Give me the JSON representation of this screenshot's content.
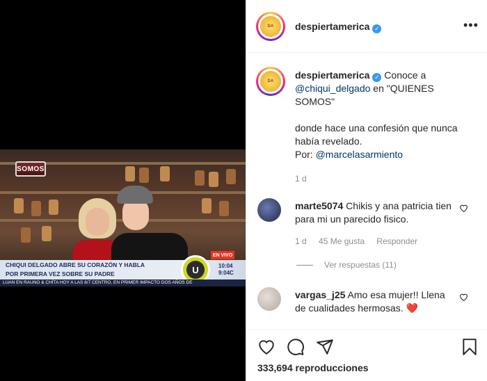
{
  "video": {
    "badge": "SOMOS",
    "live_badge": "EN VIVO",
    "headline_line1": "CHIQUI DELGADO ABRE SU CORAZÓN Y HABLA",
    "headline_line2": "POR PRIMERA VEZ SOBRE SU PADRE",
    "clock_line1": "10:04",
    "clock_line2": "9:04C",
    "ticker": "LUAN EN RAUNO & CHÍTA  HOY A LAS 8/7 CENTRO, EN PRIMER IMPACTO DOS AÑOS DE"
  },
  "post": {
    "username": "despiertamerica",
    "caption_intro": "Conoce a",
    "mention1": "@chiqui_delgado",
    "caption_mid": "en \"QUIENES SOMOS\"",
    "caption_body": "donde hace una confesión que nunca había revelado.",
    "caption_by": "Por:",
    "mention2": "@marcelasarmiento",
    "time": "1 d",
    "views": "333,694 reproducciones"
  },
  "comments": [
    {
      "username": "marte5074",
      "text": "Chikis y ana patricia tien para mi un parecido fisico.",
      "time": "1 d",
      "likes": "45 Me gusta",
      "reply": "Responder",
      "view_replies": "Ver respuestas (11)"
    },
    {
      "username": "vargas_j25",
      "text": "Amo esa mujer!! Llena de cualidades hermosas.",
      "emoji": "❤️"
    }
  ],
  "colors": {
    "accent_link": "#00376b",
    "verified": "#3897f0",
    "live": "#e8351e",
    "heart_emoji": "#e0245e"
  },
  "icons": [
    "more-options-icon",
    "verified-icon",
    "heart-icon",
    "comment-icon",
    "share-icon",
    "bookmark-icon",
    "like-comment-icon"
  ]
}
